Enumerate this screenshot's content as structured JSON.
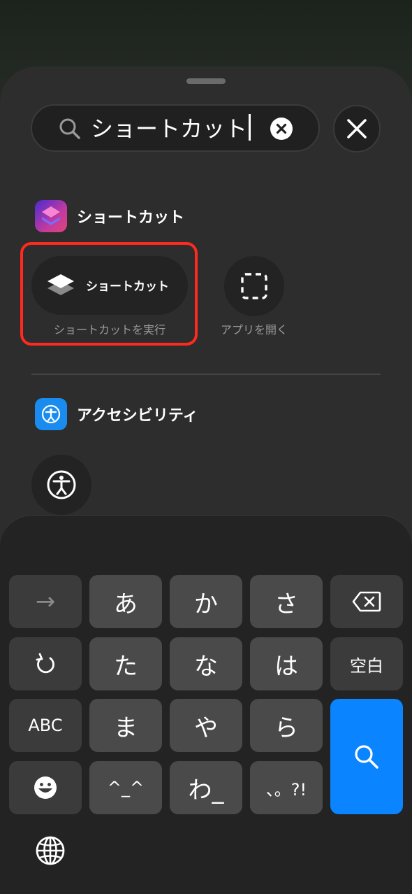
{
  "search": {
    "query": "ショートカット"
  },
  "sections": {
    "shortcuts": {
      "app_label": "ショートカット",
      "actions": [
        {
          "label": "ショートカット",
          "caption": "ショートカットを実行"
        },
        {
          "label": "",
          "caption": "アプリを開く"
        }
      ]
    },
    "accessibility": {
      "app_label": "アクセシビリティ"
    }
  },
  "keyboard": {
    "row1": [
      "→",
      "あ",
      "か",
      "さ"
    ],
    "row2": [
      "た",
      "な",
      "は",
      "空白"
    ],
    "row3": [
      "ABC",
      "ま",
      "や",
      "ら"
    ],
    "row4": [
      "^_^",
      "わ_",
      "、。?!"
    ]
  },
  "colors": {
    "highlight": "#ff2a1f",
    "search_key": "#0a84ff",
    "accessibility_icon": "#1a8cf0"
  }
}
